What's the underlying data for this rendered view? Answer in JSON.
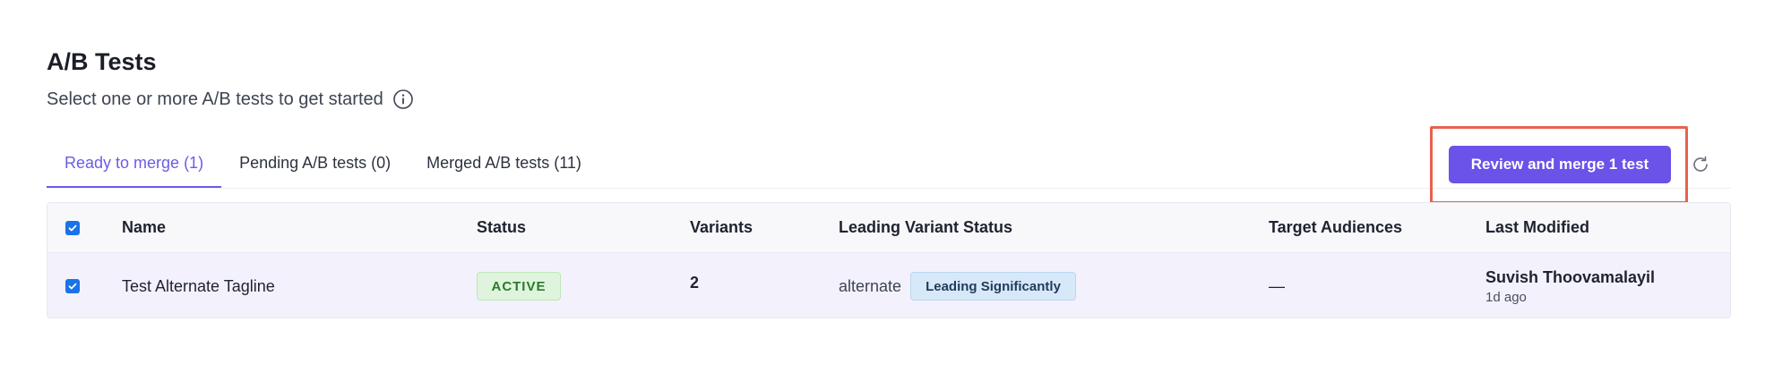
{
  "header": {
    "title": "A/B Tests",
    "subtitle": "Select one or more A/B tests to get started"
  },
  "tabs": [
    {
      "label": "Ready to merge (1)",
      "active": true
    },
    {
      "label": "Pending A/B tests (0)",
      "active": false
    },
    {
      "label": "Merged A/B tests (11)",
      "active": false
    }
  ],
  "actions": {
    "review_label": "Review and merge 1 test"
  },
  "table": {
    "columns": [
      "Name",
      "Status",
      "Variants",
      "Leading Variant Status",
      "Target Audiences",
      "Last Modified"
    ],
    "rows": [
      {
        "checked": true,
        "name": "Test Alternate Tagline",
        "status": "ACTIVE",
        "variants": "2",
        "leading_variant": "alternate",
        "leading_status": "Leading Significantly",
        "target_audiences": "—",
        "modified_by": "Suvish Thoovamalayil",
        "modified_when": "1d ago"
      }
    ]
  },
  "colors": {
    "accent": "#6b52e8",
    "highlight": "#e8624d",
    "active_badge": "#dff4dc",
    "leading_badge": "#d7e9f8"
  }
}
